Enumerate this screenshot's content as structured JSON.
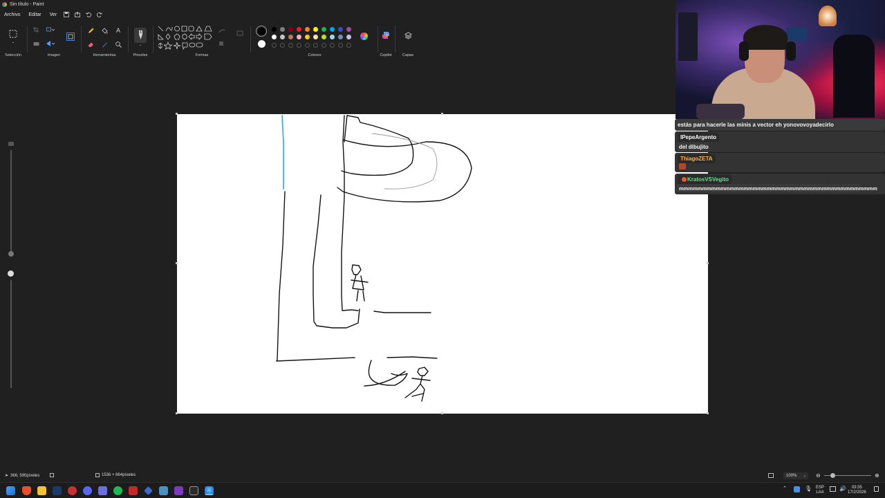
{
  "window": {
    "title": "Sin título - Paint"
  },
  "menu": {
    "file": "Archivo",
    "edit": "Editar",
    "view": "Ver"
  },
  "ribbon": {
    "selection": "Selección",
    "image": "Imagen",
    "tools": "Herramientas",
    "brushes": "Pinceles",
    "shapes": "Formas",
    "colors": "Colores",
    "copilot": "Copilot",
    "layers": "Capas"
  },
  "palette": {
    "primary": "#000000",
    "secondary": "#ffffff",
    "row1": [
      "#000000",
      "#7f7f7f",
      "#880015",
      "#ed1c24",
      "#ff7f27",
      "#fff200",
      "#22b14c",
      "#00a2e8",
      "#3f48cc",
      "#a349a4"
    ],
    "row2": [
      "#ffffff",
      "#c3c3c3",
      "#b97a57",
      "#ffaec9",
      "#ffc90e",
      "#efe4b0",
      "#b5e61d",
      "#99d9ea",
      "#7092be",
      "#c8bfe7"
    ]
  },
  "chat": {
    "messages": [
      {
        "user": "",
        "text": "estás para hacerle las minis a vector eh yonovovoyadecirlo",
        "color": "#f5f5f5"
      },
      {
        "user": "IPepeArgento",
        "text": "del dibujito",
        "color": "#ffffff"
      },
      {
        "user": "ThiagoZETA",
        "text": "",
        "color": "#ffb04a"
      },
      {
        "user": "KratosVSVegito",
        "text": "mmmmmmmmmmmmmmmmmmmmmmmmmmmmmmmmmmmmmmmmmmm",
        "color": "#5fe08a"
      }
    ]
  },
  "status": {
    "cursor_position": "366, 590píxeles",
    "canvas_size": "1536 × 864píxeles",
    "zoom": "100%"
  },
  "taskbar": {
    "lang_top": "ESP",
    "lang_bottom": "LAA",
    "time": "03:35",
    "date": "17/2/2026"
  }
}
